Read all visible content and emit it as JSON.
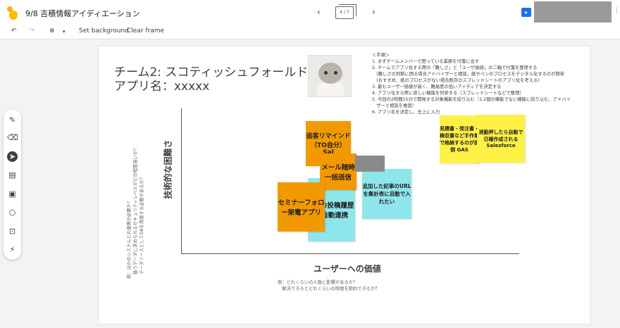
{
  "app": {
    "title": "9/8 吉積情報アイディエーション",
    "nav_prev": "‹",
    "nav_next": "›",
    "frame_counter": "4 / 7",
    "more": "⋮"
  },
  "toolbar": {
    "undo": "↶",
    "redo": "↷",
    "zoom": "⊕",
    "zoom_caret": "▾",
    "set_background": "Set background",
    "clear_frame": "Clear frame"
  },
  "tools": {
    "pen": "✎",
    "eraser": "⌫",
    "select": "➤",
    "sticky": "▤",
    "image": "▣",
    "shape": "○",
    "text": "⊡",
    "laser": "⚡"
  },
  "slide": {
    "title_line1": "チーム2: スコティッシュフォールド",
    "title_line2": "アプリ名：xxxxx",
    "steps": [
      "＜手順＞",
      "1. まずチームメンバーで困っている業務を付箋に出す",
      "2. チームでアプリ化する際の「難しさ」と「ユーザ価値」の二軸で付箋を整理する",
      "　(難しさの判断に困る場合アドバイザーと相談、紙やペンのプロセスをデジタル化するのが簡単",
      "　(おすすめ、紙のプロセスがない場合既存のスプレッドシートのアプリ化を考える)",
      "3. 最もユーザー価値が高く、難易度の低いアイディアを決定する",
      "4. アプリ化する際に欲しい機能を列挙する（スプレッドシートなどで整理）",
      "5. 今回の2時間15分で開発する対象機能を絞り込む（1,2個の機能でない機能に絞り込む、アドバイ",
      "　ザーと相談を推奨）",
      "6. アプリ名を決定し、左上に入力"
    ],
    "axis_y_label": "技術的な困難さ",
    "axis_x_label": "ユーザーへの価値",
    "note_y_1": "例：ほかのシステムとの連携が必要か？",
    "note_y_2": "　扱うデータに求められるセキュリティレベルがどの程度高いか？",
    "note_y_3": "　データソースとしてDBを用意する必要があるか？",
    "note_x_1": "例：どれくらいの人数に影響があるか？",
    "note_x_2": "　解決できるとどれくらいの時間を節約できるか？"
  },
  "stickies": [
    {
      "text": "追客リマインド（TO自分）Sal",
      "color": "#f29900"
    },
    {
      "text": "メール随時一括送信",
      "color": "#f29900"
    },
    {
      "text": "追加した記事のURLを集計表に自動で入れたい",
      "color": "#8fe6ea"
    },
    {
      "text": "Sへの投稿履歴を自動連携",
      "color": "#8fe6ea"
    },
    {
      "text": "セミナーフォロー架電アプリ",
      "color": "#f29900"
    },
    {
      "text": "見積書・発注書・検収書など手作業で格納するのが面倒 GAS",
      "color": "#fff146"
    },
    {
      "text": "退勤押したら自動で日報作成される Salesforce",
      "color": "#fff146"
    }
  ]
}
